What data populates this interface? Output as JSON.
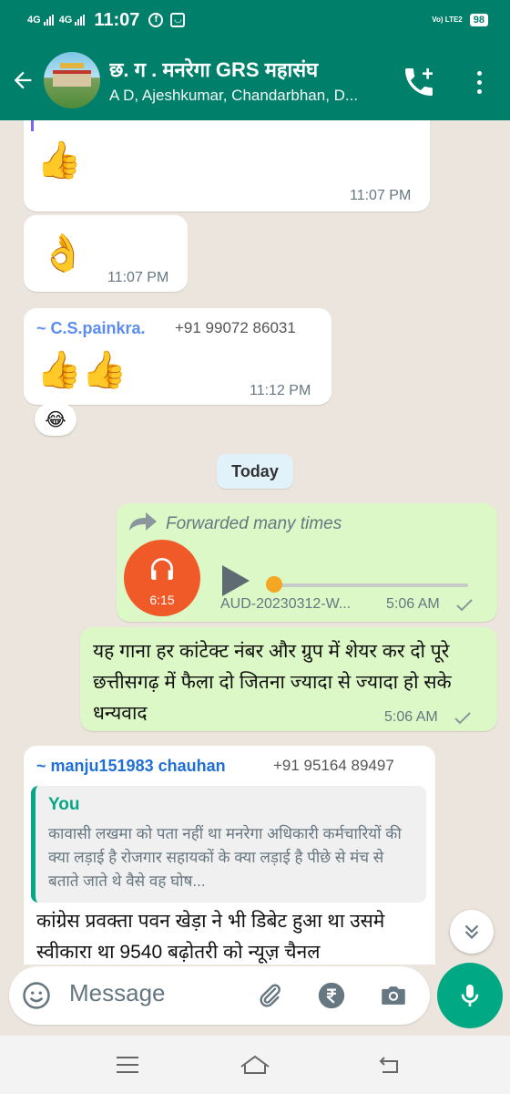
{
  "status_bar": {
    "net1": "4G",
    "net2": "4G",
    "time": "11:07",
    "lte": "Vo) LTE2",
    "battery": "98"
  },
  "header": {
    "title": "छ. ग . मनरेगा GRS महासंघ",
    "subtitle": "A D, Ajeshkumar, Chandarbhan, D..."
  },
  "messages": {
    "m1_time": "11:07 PM",
    "m2_time": "11:07 PM",
    "m3_sender": "~ C.S.painkra.",
    "m3_phone": "+91 99072 86031",
    "m3_time": "11:12 PM",
    "m3_reaction": "😂",
    "day_label": "Today",
    "audio": {
      "forwarded": "Forwarded many times",
      "duration": "6:15",
      "file_name": "AUD-20230312-W...",
      "time": "5:06 AM",
      "progress": 0.0
    },
    "m5_text": "यह गाना हर कांटेक्ट नंबर और ग्रुप में शेयर कर दो पूरे छत्तीसगढ़ में फैला दो जितना ज्यादा से ज्यादा हो सके धन्यवाद",
    "m5_time": "5:06 AM",
    "m6_sender": "~ manju151983 chauhan",
    "m6_phone": "+91 95164 89497",
    "m6_quote_author": "You",
    "m6_quote_text": "कावासी लखमा को पता नहीं था मनरेगा अधिकारी कर्मचारियों की क्या लड़ाई है रोजगार सहायकों के क्या लड़ाई है पीछे से मंच से बताते जाते थे वैसे वह घोष...",
    "m6_text": "कांग्रेस प्रवक्ता पवन खेड़ा ने भी डिबेट हुआ था उसमे स्वीकारा था 9540 बढ़ोतरी को न्यूज़ चैनल"
  },
  "input": {
    "placeholder": "Message"
  },
  "colors": {
    "header": "#00806b",
    "outgoing_bubble": "#dcf8c6",
    "accent": "#00a884",
    "sender1": "#5b8def",
    "sender2": "#1f6fd6"
  }
}
